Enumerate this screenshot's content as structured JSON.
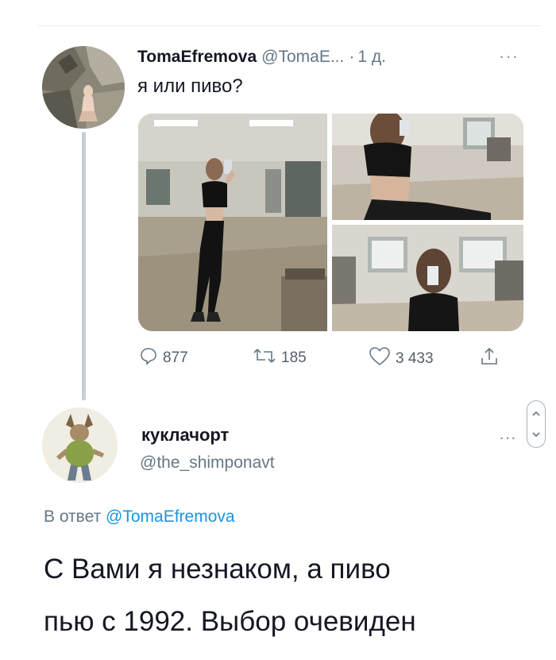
{
  "tweet": {
    "author_name": "TomaEfremova",
    "author_handle": "@TomaE...",
    "time": "1 д.",
    "separator": "·",
    "more": "···",
    "text": "я или пиво?",
    "media_count": 3,
    "stats": {
      "replies": "877",
      "retweets": "185",
      "likes": "3 433"
    }
  },
  "reply": {
    "author_name": "куклачорт",
    "author_handle": "@the_shimponavt",
    "more": "···",
    "reply_to_label": "В ответ",
    "reply_to_mention": "@TomaEfremova",
    "text_line1": "С Вами я незнаком, а пиво",
    "text_line2": "пью с 1992. Выбор очевиден"
  },
  "icons": {
    "reply": "comment-icon",
    "retweet": "retweet-icon",
    "like": "heart-icon",
    "share": "share-icon"
  },
  "colors": {
    "text": "#141823",
    "secondary": "#657786",
    "link": "#1b95e0",
    "thread_line": "#c4cfd6"
  }
}
